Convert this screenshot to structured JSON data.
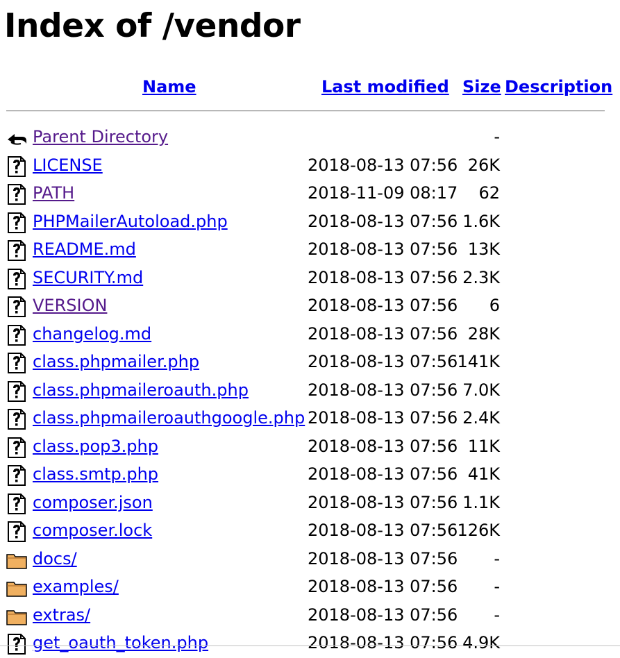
{
  "page": {
    "title": "Index of /vendor"
  },
  "columns": {
    "name": "Name",
    "modified": "Last modified",
    "size": "Size",
    "description": "Description"
  },
  "rows": [
    {
      "icon": "back-icon",
      "name": "Parent Directory",
      "modified": "",
      "size": "-",
      "visited": true
    },
    {
      "icon": "unknown-file-icon",
      "name": "LICENSE",
      "modified": "2018-08-13 07:56",
      "size": "26K",
      "visited": false
    },
    {
      "icon": "unknown-file-icon",
      "name": "PATH",
      "modified": "2018-11-09 08:17",
      "size": "62",
      "visited": true
    },
    {
      "icon": "unknown-file-icon",
      "name": "PHPMailerAutoload.php",
      "modified": "2018-08-13 07:56",
      "size": "1.6K",
      "visited": false
    },
    {
      "icon": "unknown-file-icon",
      "name": "README.md",
      "modified": "2018-08-13 07:56",
      "size": "13K",
      "visited": false
    },
    {
      "icon": "unknown-file-icon",
      "name": "SECURITY.md",
      "modified": "2018-08-13 07:56",
      "size": "2.3K",
      "visited": false
    },
    {
      "icon": "unknown-file-icon",
      "name": "VERSION",
      "modified": "2018-08-13 07:56",
      "size": "6",
      "visited": true
    },
    {
      "icon": "unknown-file-icon",
      "name": "changelog.md",
      "modified": "2018-08-13 07:56",
      "size": "28K",
      "visited": false
    },
    {
      "icon": "unknown-file-icon",
      "name": "class.phpmailer.php",
      "modified": "2018-08-13 07:56",
      "size": "141K",
      "visited": false
    },
    {
      "icon": "unknown-file-icon",
      "name": "class.phpmaileroauth.php",
      "modified": "2018-08-13 07:56",
      "size": "7.0K",
      "visited": false
    },
    {
      "icon": "unknown-file-icon",
      "name": "class.phpmaileroauthgoogle.php",
      "modified": "2018-08-13 07:56",
      "size": "2.4K",
      "visited": false
    },
    {
      "icon": "unknown-file-icon",
      "name": "class.pop3.php",
      "modified": "2018-08-13 07:56",
      "size": "11K",
      "visited": false
    },
    {
      "icon": "unknown-file-icon",
      "name": "class.smtp.php",
      "modified": "2018-08-13 07:56",
      "size": "41K",
      "visited": false
    },
    {
      "icon": "unknown-file-icon",
      "name": "composer.json",
      "modified": "2018-08-13 07:56",
      "size": "1.1K",
      "visited": false
    },
    {
      "icon": "unknown-file-icon",
      "name": "composer.lock",
      "modified": "2018-08-13 07:56",
      "size": "126K",
      "visited": false
    },
    {
      "icon": "folder-icon",
      "name": "docs/",
      "modified": "2018-08-13 07:56",
      "size": "-",
      "visited": false
    },
    {
      "icon": "folder-icon",
      "name": "examples/",
      "modified": "2018-08-13 07:56",
      "size": "-",
      "visited": false
    },
    {
      "icon": "folder-icon",
      "name": "extras/",
      "modified": "2018-08-13 07:56",
      "size": "-",
      "visited": false
    },
    {
      "icon": "unknown-file-icon",
      "name": "get_oauth_token.php",
      "modified": "2018-08-13 07:56",
      "size": "4.9K",
      "visited": false
    }
  ],
  "colors": {
    "link": "#0000ee",
    "visited": "#551a8b",
    "folder": "#f0b060"
  }
}
